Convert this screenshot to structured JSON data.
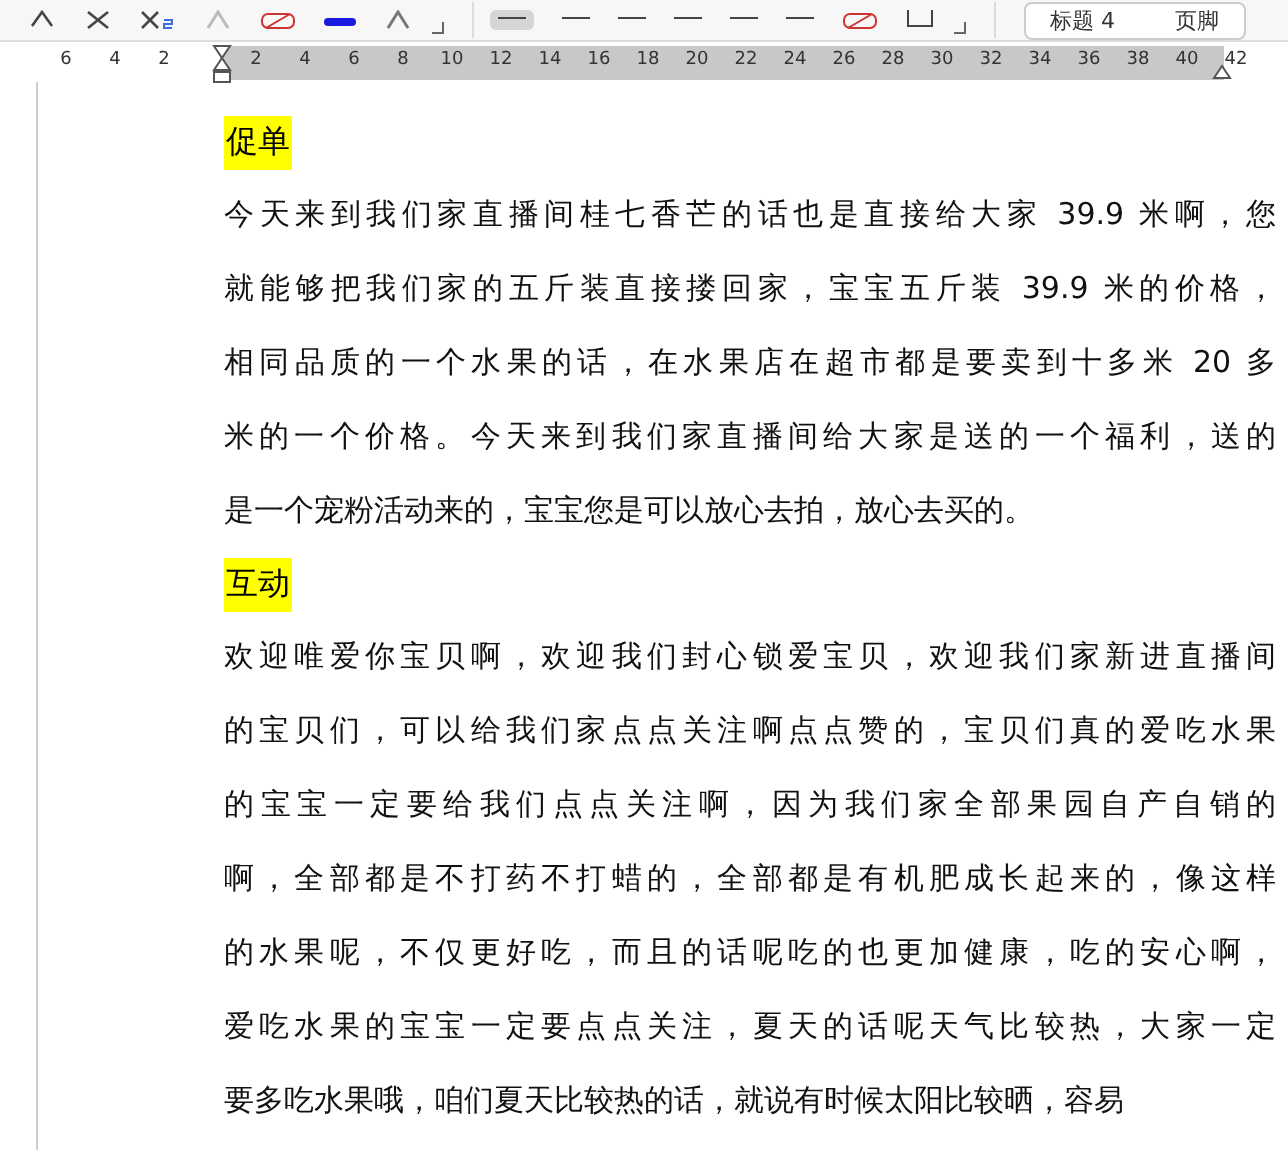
{
  "style_gallery": [
    {
      "label": "标题 4"
    },
    {
      "label": "页脚"
    }
  ],
  "ruler": {
    "ticks": [
      "6",
      "4",
      "2",
      "2",
      "4",
      "6",
      "8",
      "10",
      "12",
      "14",
      "16",
      "18",
      "20",
      "22",
      "24",
      "26",
      "28",
      "30",
      "32",
      "34",
      "36",
      "38",
      "40",
      "42"
    ]
  },
  "document": [
    {
      "kind": "heading",
      "text": "促单",
      "color": "#ffff00"
    },
    {
      "kind": "paragraph",
      "lines": [
        "今天来到我们家直播间桂七香芒的话也是直接给大家 39.9 米啊，您",
        "就能够把我们家的五斤装直接搂回家，宝宝五斤装 39.9 米的价格，",
        "相同品质的一个水果的话，在水果店在超市都是要卖到十多米 20 多",
        "米的一个价格。今天来到我们家直播间给大家是送的一个福利，送的",
        "是一个宠粉活动来的，宝宝您是可以放心去拍，放心去买的。"
      ]
    },
    {
      "kind": "heading",
      "text": "互动",
      "color": "#ffff00"
    },
    {
      "kind": "paragraph",
      "lines": [
        "欢迎唯爱你宝贝啊，欢迎我们封心锁爱宝贝，欢迎我们家新进直播间",
        "的宝贝们，可以给我们家点点关注啊点点赞的，宝贝们真的爱吃水果",
        "的宝宝一定要给我们点点关注啊，因为我们家全部果园自产自销的",
        "啊，全部都是不打药不打蜡的，全部都是有机肥成长起来的，像这样",
        "的水果呢，不仅更好吃，而且的话呢吃的也更加健康，吃的安心啊，",
        "爱吃水果的宝宝一定要点点关注，夏天的话呢天气比较热，大家一定",
        "要多吃水果哦，咱们夏天比较热的话，就说有时候太阳比较晒，容易"
      ]
    }
  ]
}
